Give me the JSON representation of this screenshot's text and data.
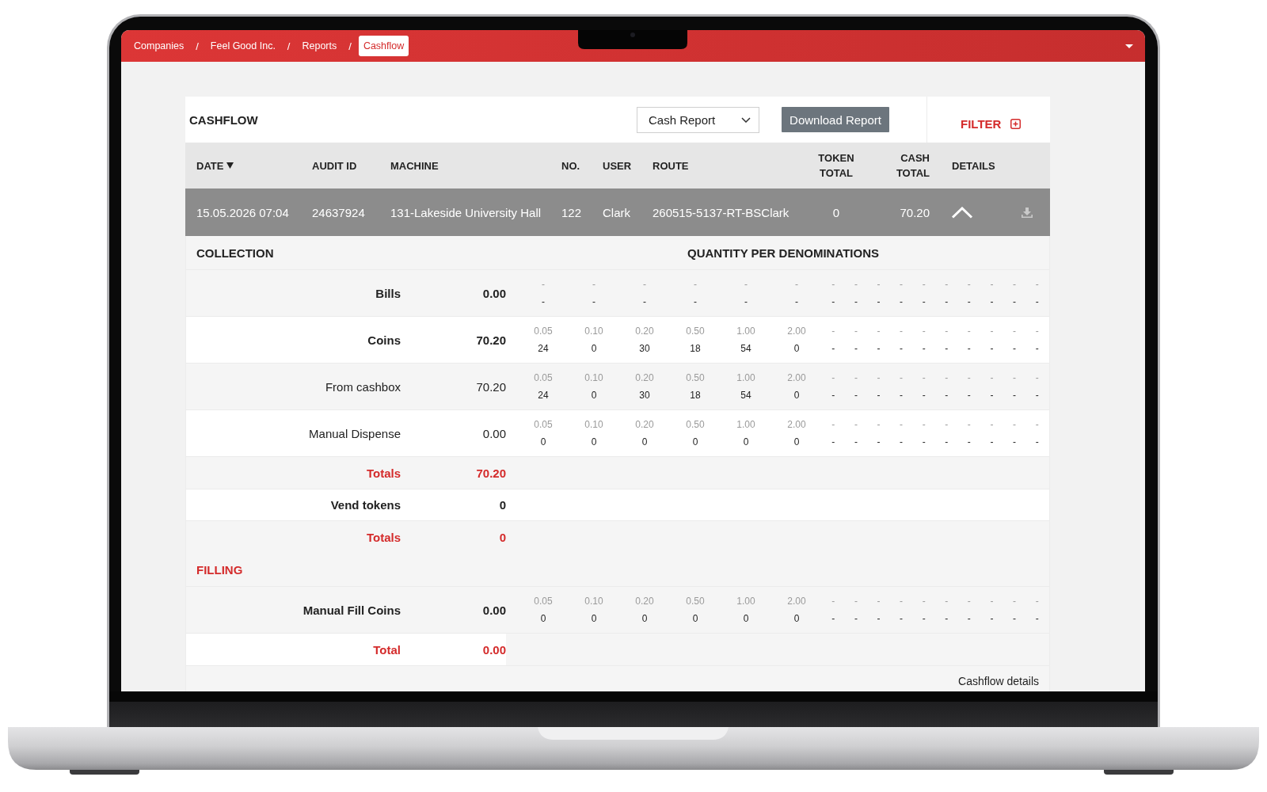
{
  "breadcrumb": [
    {
      "label": "Companies",
      "selected": false,
      "separator": "/"
    },
    {
      "label": "Feel Good Inc.",
      "selected": false,
      "separator": "/"
    },
    {
      "label": "Reports",
      "selected": false,
      "separator": "/"
    },
    {
      "label": "Cashflow",
      "selected": true
    }
  ],
  "card": {
    "title": "CASHFLOW",
    "report_select": {
      "value": "Cash Report"
    },
    "download_button": "Download Report",
    "filter_button": "FILTER"
  },
  "table": {
    "columns": [
      {
        "label": "DATE",
        "sorted": true
      },
      {
        "label": "AUDIT ID",
        "sorted": false
      },
      {
        "label": "MACHINE",
        "sorted": false
      },
      {
        "label": "NO.",
        "sorted": false
      },
      {
        "label": "USER",
        "sorted": false
      },
      {
        "label": "ROUTE",
        "sorted": false
      },
      {
        "label": "TOKEN TOTAL",
        "sorted": false
      },
      {
        "label": "CASH TOTAL",
        "sorted": false
      },
      {
        "label": "DETAILS",
        "sorted": false
      }
    ],
    "rows": [
      {
        "cells": [
          "15.05.2026 07:04",
          "24637924",
          "131-Lakeside University Hall",
          "122",
          "Clark",
          "260515-5137-RT-BSClark",
          "0",
          "70.20"
        ],
        "selected": true,
        "expanded": true
      }
    ]
  },
  "details": {
    "sections": [
      {
        "title": "COLLECTION",
        "accent": false,
        "subtitle": "QUANTITY PER DENOMINATIONS",
        "rows": [
          {
            "kind": "denominations",
            "label": "Bills",
            "amount": "0.00",
            "bold": true,
            "slots": [
              {
                "denomination": "-",
                "quantity": "-"
              },
              {
                "denomination": "-",
                "quantity": "-"
              },
              {
                "denomination": "-",
                "quantity": "-"
              },
              {
                "denomination": "-",
                "quantity": "-"
              },
              {
                "denomination": "-",
                "quantity": "-"
              },
              {
                "denomination": "-",
                "quantity": "-"
              },
              {
                "denomination": "-",
                "quantity": "-"
              },
              {
                "denomination": "-",
                "quantity": "-"
              },
              {
                "denomination": "-",
                "quantity": "-"
              },
              {
                "denomination": "-",
                "quantity": "-"
              },
              {
                "denomination": "-",
                "quantity": "-"
              },
              {
                "denomination": "-",
                "quantity": "-"
              },
              {
                "denomination": "-",
                "quantity": "-"
              },
              {
                "denomination": "-",
                "quantity": "-"
              },
              {
                "denomination": "-",
                "quantity": "-"
              },
              {
                "denomination": "-",
                "quantity": "-"
              }
            ]
          },
          {
            "kind": "denominations",
            "label": "Coins",
            "amount": "70.20",
            "bold": true,
            "slots": [
              {
                "denomination": "0.05",
                "quantity": "24"
              },
              {
                "denomination": "0.10",
                "quantity": "0"
              },
              {
                "denomination": "0.20",
                "quantity": "30"
              },
              {
                "denomination": "0.50",
                "quantity": "18"
              },
              {
                "denomination": "1.00",
                "quantity": "54"
              },
              {
                "denomination": "2.00",
                "quantity": "0"
              },
              {
                "denomination": "-",
                "quantity": "-"
              },
              {
                "denomination": "-",
                "quantity": "-"
              },
              {
                "denomination": "-",
                "quantity": "-"
              },
              {
                "denomination": "-",
                "quantity": "-"
              },
              {
                "denomination": "-",
                "quantity": "-"
              },
              {
                "denomination": "-",
                "quantity": "-"
              },
              {
                "denomination": "-",
                "quantity": "-"
              },
              {
                "denomination": "-",
                "quantity": "-"
              },
              {
                "denomination": "-",
                "quantity": "-"
              },
              {
                "denomination": "-",
                "quantity": "-"
              }
            ]
          },
          {
            "kind": "denominations",
            "label": "From cashbox",
            "amount": "70.20",
            "bold": false,
            "slots": [
              {
                "denomination": "0.05",
                "quantity": "24"
              },
              {
                "denomination": "0.10",
                "quantity": "0"
              },
              {
                "denomination": "0.20",
                "quantity": "30"
              },
              {
                "denomination": "0.50",
                "quantity": "18"
              },
              {
                "denomination": "1.00",
                "quantity": "54"
              },
              {
                "denomination": "2.00",
                "quantity": "0"
              },
              {
                "denomination": "-",
                "quantity": "-"
              },
              {
                "denomination": "-",
                "quantity": "-"
              },
              {
                "denomination": "-",
                "quantity": "-"
              },
              {
                "denomination": "-",
                "quantity": "-"
              },
              {
                "denomination": "-",
                "quantity": "-"
              },
              {
                "denomination": "-",
                "quantity": "-"
              },
              {
                "denomination": "-",
                "quantity": "-"
              },
              {
                "denomination": "-",
                "quantity": "-"
              },
              {
                "denomination": "-",
                "quantity": "-"
              },
              {
                "denomination": "-",
                "quantity": "-"
              }
            ]
          },
          {
            "kind": "denominations",
            "label": "Manual Dispense",
            "amount": "0.00",
            "bold": false,
            "slots": [
              {
                "denomination": "0.05",
                "quantity": "0"
              },
              {
                "denomination": "0.10",
                "quantity": "0"
              },
              {
                "denomination": "0.20",
                "quantity": "0"
              },
              {
                "denomination": "0.50",
                "quantity": "0"
              },
              {
                "denomination": "1.00",
                "quantity": "0"
              },
              {
                "denomination": "2.00",
                "quantity": "0"
              },
              {
                "denomination": "-",
                "quantity": "-"
              },
              {
                "denomination": "-",
                "quantity": "-"
              },
              {
                "denomination": "-",
                "quantity": "-"
              },
              {
                "denomination": "-",
                "quantity": "-"
              },
              {
                "denomination": "-",
                "quantity": "-"
              },
              {
                "denomination": "-",
                "quantity": "-"
              },
              {
                "denomination": "-",
                "quantity": "-"
              },
              {
                "denomination": "-",
                "quantity": "-"
              },
              {
                "denomination": "-",
                "quantity": "-"
              },
              {
                "denomination": "-",
                "quantity": "-"
              }
            ]
          },
          {
            "kind": "total",
            "label": "Totals",
            "amount": "70.20"
          },
          {
            "kind": "amount",
            "label": "Vend tokens",
            "amount": "0",
            "bold": true
          },
          {
            "kind": "total",
            "label": "Totals",
            "amount": "0"
          }
        ]
      },
      {
        "title": "FILLING",
        "accent": true,
        "rows": [
          {
            "kind": "denominations",
            "label": "Manual Fill Coins",
            "amount": "0.00",
            "bold": true,
            "slots": [
              {
                "denomination": "0.05",
                "quantity": "0"
              },
              {
                "denomination": "0.10",
                "quantity": "0"
              },
              {
                "denomination": "0.20",
                "quantity": "0"
              },
              {
                "denomination": "0.50",
                "quantity": "0"
              },
              {
                "denomination": "1.00",
                "quantity": "0"
              },
              {
                "denomination": "2.00",
                "quantity": "0"
              },
              {
                "denomination": "-",
                "quantity": "-"
              },
              {
                "denomination": "-",
                "quantity": "-"
              },
              {
                "denomination": "-",
                "quantity": "-"
              },
              {
                "denomination": "-",
                "quantity": "-"
              },
              {
                "denomination": "-",
                "quantity": "-"
              },
              {
                "denomination": "-",
                "quantity": "-"
              },
              {
                "denomination": "-",
                "quantity": "-"
              },
              {
                "denomination": "-",
                "quantity": "-"
              },
              {
                "denomination": "-",
                "quantity": "-"
              },
              {
                "denomination": "-",
                "quantity": "-"
              }
            ]
          },
          {
            "kind": "total",
            "label": "Total",
            "amount": "0.00"
          }
        ]
      }
    ],
    "footer_link": "Cashflow details"
  }
}
